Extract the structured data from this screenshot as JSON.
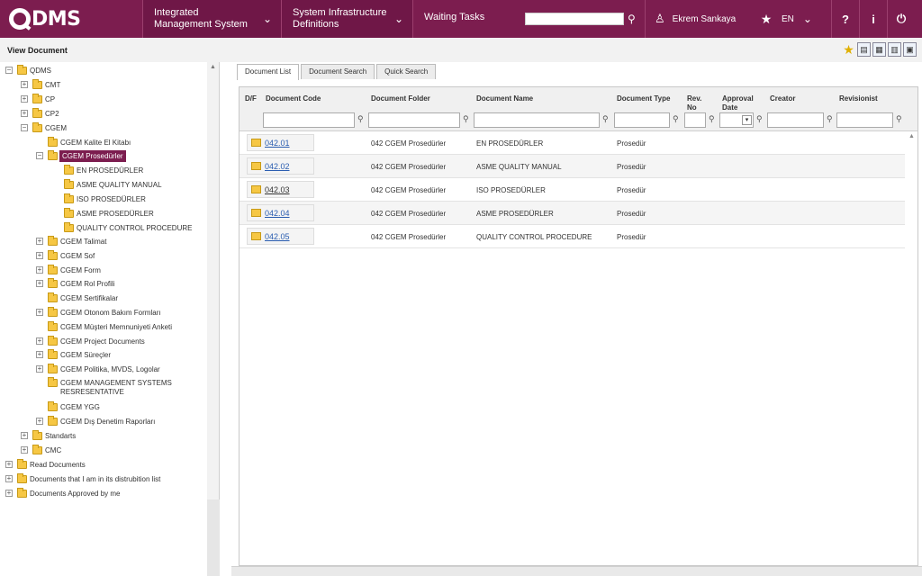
{
  "header": {
    "logo": "DMS",
    "nav": [
      {
        "label": "Integrated Management System"
      },
      {
        "label": "System Infrastructure Definitions"
      },
      {
        "label": "Waiting Tasks"
      }
    ],
    "search": {
      "placeholder": "",
      "value": ""
    },
    "user": "Ekrem Sankaya",
    "lang": "EN",
    "help": "?",
    "info": "i"
  },
  "page": {
    "title": "View Document"
  },
  "tree": {
    "root": "QDMS",
    "items": [
      {
        "label": "CMT"
      },
      {
        "label": "CP"
      },
      {
        "label": "CP2"
      },
      {
        "label": "CGEM"
      },
      {
        "label": "CGEM Kalite El Kitabı"
      },
      {
        "label": "CGEM Prosedürler"
      },
      {
        "label": "EN PROSEDÜRLER"
      },
      {
        "label": "ASME QUALITY MANUAL"
      },
      {
        "label": "ISO PROSEDÜRLER"
      },
      {
        "label": "ASME PROSEDÜRLER"
      },
      {
        "label": "QUALITY CONTROL PROCEDURE"
      },
      {
        "label": "CGEM Talimat"
      },
      {
        "label": "CGEM Sof"
      },
      {
        "label": "CGEM Form"
      },
      {
        "label": "CGEM Rol Profili"
      },
      {
        "label": "CGEM Sertifikalar"
      },
      {
        "label": "CGEM Otonom Bakım Formları"
      },
      {
        "label": "CGEM Müşteri Memnuniyeti Anketi"
      },
      {
        "label": "CGEM Project Documents"
      },
      {
        "label": "CGEM Süreçler"
      },
      {
        "label": "CGEM Politika, MVDS, Logolar"
      },
      {
        "label": "CGEM MANAGEMENT SYSTEMS RESRESENTATIVE"
      },
      {
        "label": "CGEM YGG"
      },
      {
        "label": "CGEM Dış Denetim Raporları"
      },
      {
        "label": "Standarts"
      },
      {
        "label": "CMC"
      },
      {
        "label": "Read Documents"
      },
      {
        "label": "Documents that I am in its distrubition list"
      },
      {
        "label": "Documents Approved by me"
      }
    ]
  },
  "tabs": [
    {
      "label": "Document List"
    },
    {
      "label": "Document Search"
    },
    {
      "label": "Quick Search"
    }
  ],
  "grid": {
    "columns": [
      "D/F",
      "Document Code",
      "Document Folder",
      "Document Name",
      "Document Type",
      "Rev. No",
      "Approval Date",
      "Creator",
      "Revisionist"
    ],
    "rows": [
      {
        "code": "042.01",
        "folder": "042 CGEM Prosedürler",
        "name": "EN PROSEDÜRLER",
        "type": "Prosedür"
      },
      {
        "code": "042.02",
        "folder": "042 CGEM Prosedürler",
        "name": "ASME QUALITY MANUAL",
        "type": "Prosedür"
      },
      {
        "code": "042.03",
        "folder": "042 CGEM Prosedürler",
        "name": "ISO PROSEDÜRLER",
        "type": "Prosedür"
      },
      {
        "code": "042.04",
        "folder": "042 CGEM Prosedürler",
        "name": "ASME PROSEDÜRLER",
        "type": "Prosedür"
      },
      {
        "code": "042.05",
        "folder": "042 CGEM Prosedürler",
        "name": "QUALITY CONTROL PROCEDURE",
        "type": "Prosedür"
      }
    ]
  },
  "colors": {
    "brand": "#7c1d4f",
    "link": "#2a5db0",
    "folder": "#f6c744"
  }
}
